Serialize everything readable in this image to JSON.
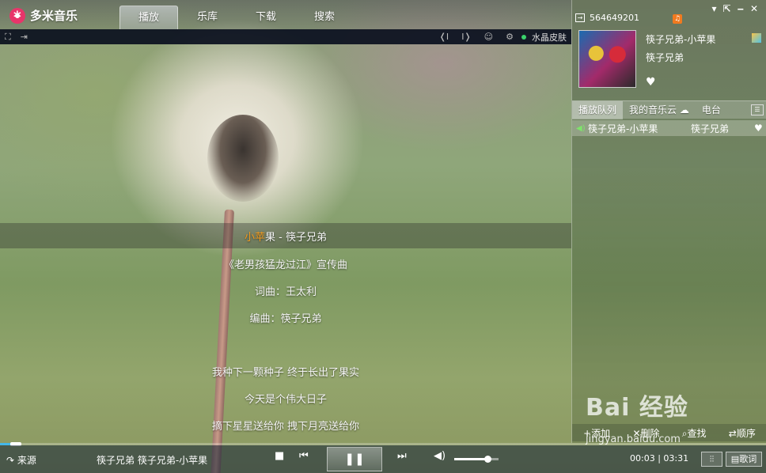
{
  "app": {
    "name": "多米音乐"
  },
  "nav": {
    "tabs": [
      {
        "label": "播放",
        "active": true
      },
      {
        "label": "乐库",
        "active": false
      },
      {
        "label": "下载",
        "active": false
      },
      {
        "label": "搜索",
        "active": false
      }
    ]
  },
  "subbar": {
    "skin_label": "水晶皮肤"
  },
  "lyrics": {
    "current_done": "小苹",
    "current_rest": "果 - 筷子兄弟",
    "lines": [
      "《老男孩猛龙过江》宣传曲",
      "词曲：王太利",
      "编曲：筷子兄弟",
      "",
      "我种下一颗种子  终于长出了果实",
      "今天是个伟大日子",
      "摘下星星送给你  拽下月亮送给你"
    ]
  },
  "user": {
    "id": "564649201"
  },
  "now_playing": {
    "title": "筷子兄弟-小苹果",
    "artist": "筷子兄弟"
  },
  "panel": {
    "tabs": [
      {
        "label": "播放队列",
        "active": true
      },
      {
        "label": "我的音乐云",
        "active": false
      },
      {
        "label": "电台",
        "active": false
      }
    ],
    "queue": [
      {
        "title": "筷子兄弟-小苹果",
        "artist": "筷子兄弟"
      }
    ],
    "actions": {
      "add": "+添加",
      "delete": "✕删除",
      "find": "查找",
      "order": "顺序"
    }
  },
  "player": {
    "source_label": "来源",
    "track_info": "筷子兄弟  筷子兄弟-小苹果",
    "elapsed": "00:03",
    "total": "03:31",
    "progress": 0.014,
    "volume": 0.75,
    "lyrics_button": "歌词"
  },
  "watermark": {
    "logo": "Bai  经验",
    "url": "jingyan.baidu.com"
  },
  "colors": {
    "accent": "#f39a1c",
    "progress": "#44b7e8",
    "logo": "#e8356a"
  }
}
